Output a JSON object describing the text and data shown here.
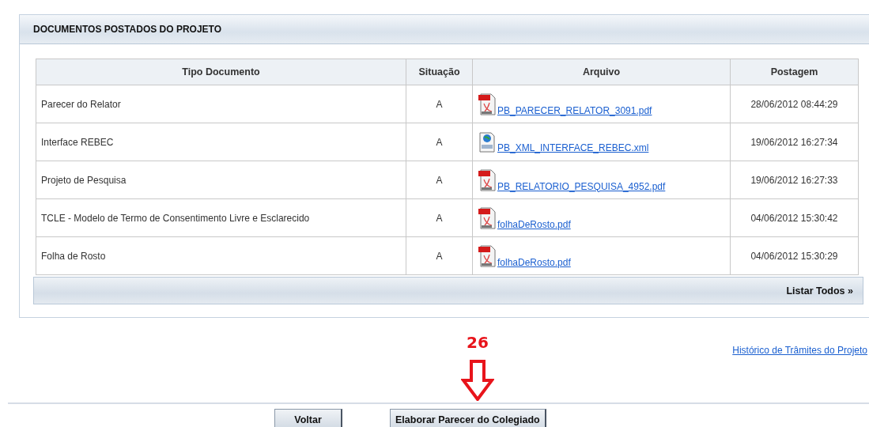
{
  "panel": {
    "title": "DOCUMENTOS POSTADOS DO PROJETO"
  },
  "table": {
    "columns": [
      "Tipo Documento",
      "Situação",
      "Arquivo",
      "Postagem"
    ],
    "rows": [
      {
        "tipo": "Parecer do Relator",
        "situacao": "A",
        "arquivo": {
          "kind": "pdf",
          "name": "PB_PARECER_RELATOR_3091.pdf"
        },
        "postagem": "28/06/2012 08:44:29"
      },
      {
        "tipo": "Interface REBEC",
        "situacao": "A",
        "arquivo": {
          "kind": "xml",
          "name": "PB_XML_INTERFACE_REBEC.xml"
        },
        "postagem": "19/06/2012 16:27:34"
      },
      {
        "tipo": "Projeto de Pesquisa",
        "situacao": "A",
        "arquivo": {
          "kind": "pdf",
          "name": "PB_RELATORIO_PESQUISA_4952.pdf"
        },
        "postagem": "19/06/2012 16:27:33"
      },
      {
        "tipo": "TCLE - Modelo de Termo de Consentimento Livre e Esclarecido",
        "situacao": "A",
        "arquivo": {
          "kind": "pdf",
          "name": "folhaDeRosto.pdf"
        },
        "postagem": "04/06/2012 15:30:42"
      },
      {
        "tipo": "Folha de Rosto",
        "situacao": "A",
        "arquivo": {
          "kind": "pdf",
          "name": "folhaDeRosto.pdf"
        },
        "postagem": "04/06/2012 15:30:29"
      }
    ]
  },
  "list_all": "Listar Todos »",
  "history_link": "Histórico de Trâmites do Projeto",
  "annotation": {
    "label": "26",
    "color": "#e8141b"
  },
  "buttons": [
    "Voltar",
    "Elaborar Parecer do Colegiado"
  ]
}
